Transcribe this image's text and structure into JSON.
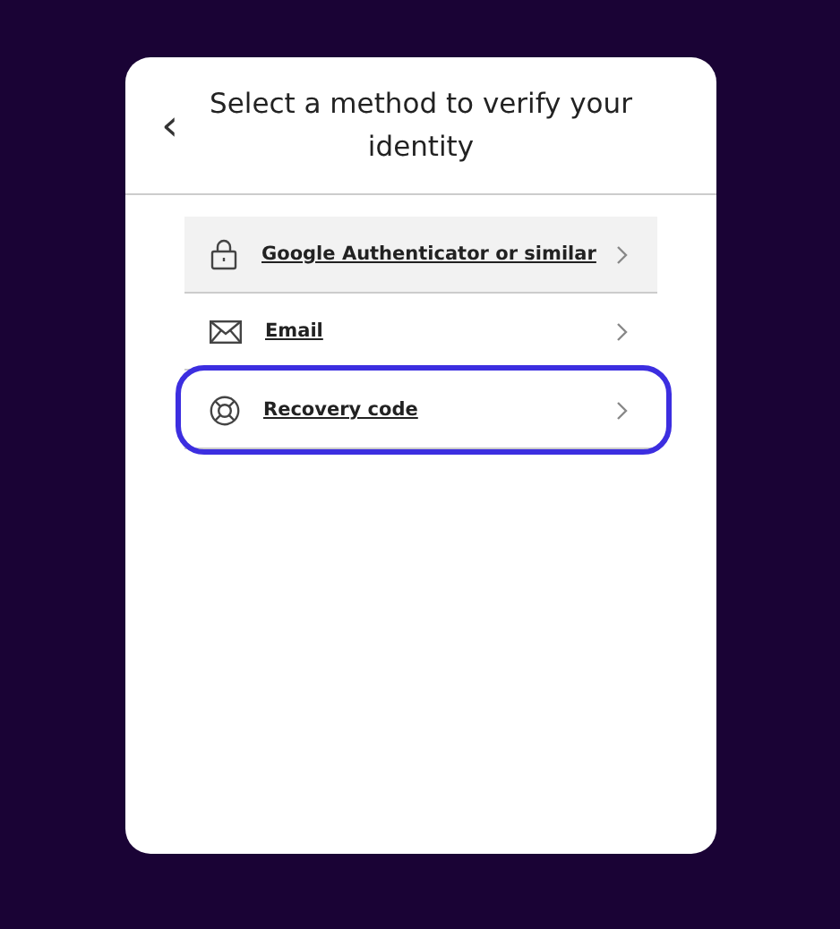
{
  "header": {
    "back": "‹",
    "title": "Select a method to verify your identity"
  },
  "methods": [
    {
      "kind": "lock",
      "label": "Google Authenticator or similar",
      "highlighted": true,
      "focused": false
    },
    {
      "kind": "envelope",
      "label": "Email",
      "highlighted": false,
      "focused": false
    },
    {
      "kind": "lifebuoy",
      "label": "Recovery code",
      "highlighted": false,
      "focused": true
    }
  ]
}
